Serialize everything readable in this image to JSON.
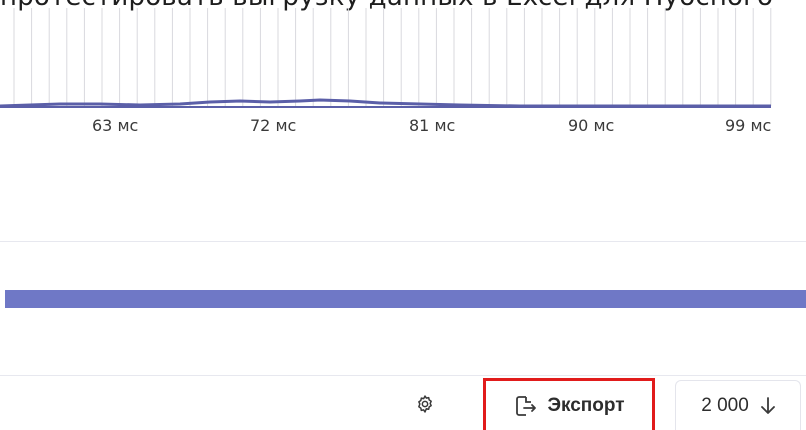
{
  "header": {
    "partial_text": "протестировать выгрузку данных в Excel для Пубсного"
  },
  "histogram": {
    "axis_ticks": [
      "63 мс",
      "72 мс",
      "81 мс",
      "90 мс",
      "99 мс"
    ],
    "colors": {
      "line": "#5b5fa8",
      "gridline": "#d9d9de",
      "bar": "#6f78c6"
    }
  },
  "toolbar": {
    "settings_icon": "gear-icon",
    "export_icon": "export-file-icon",
    "export_label": "Экспорт",
    "count_label": "2 000",
    "sort_icon": "arrow-down-icon",
    "highlight_color": "#e11b1b"
  }
}
